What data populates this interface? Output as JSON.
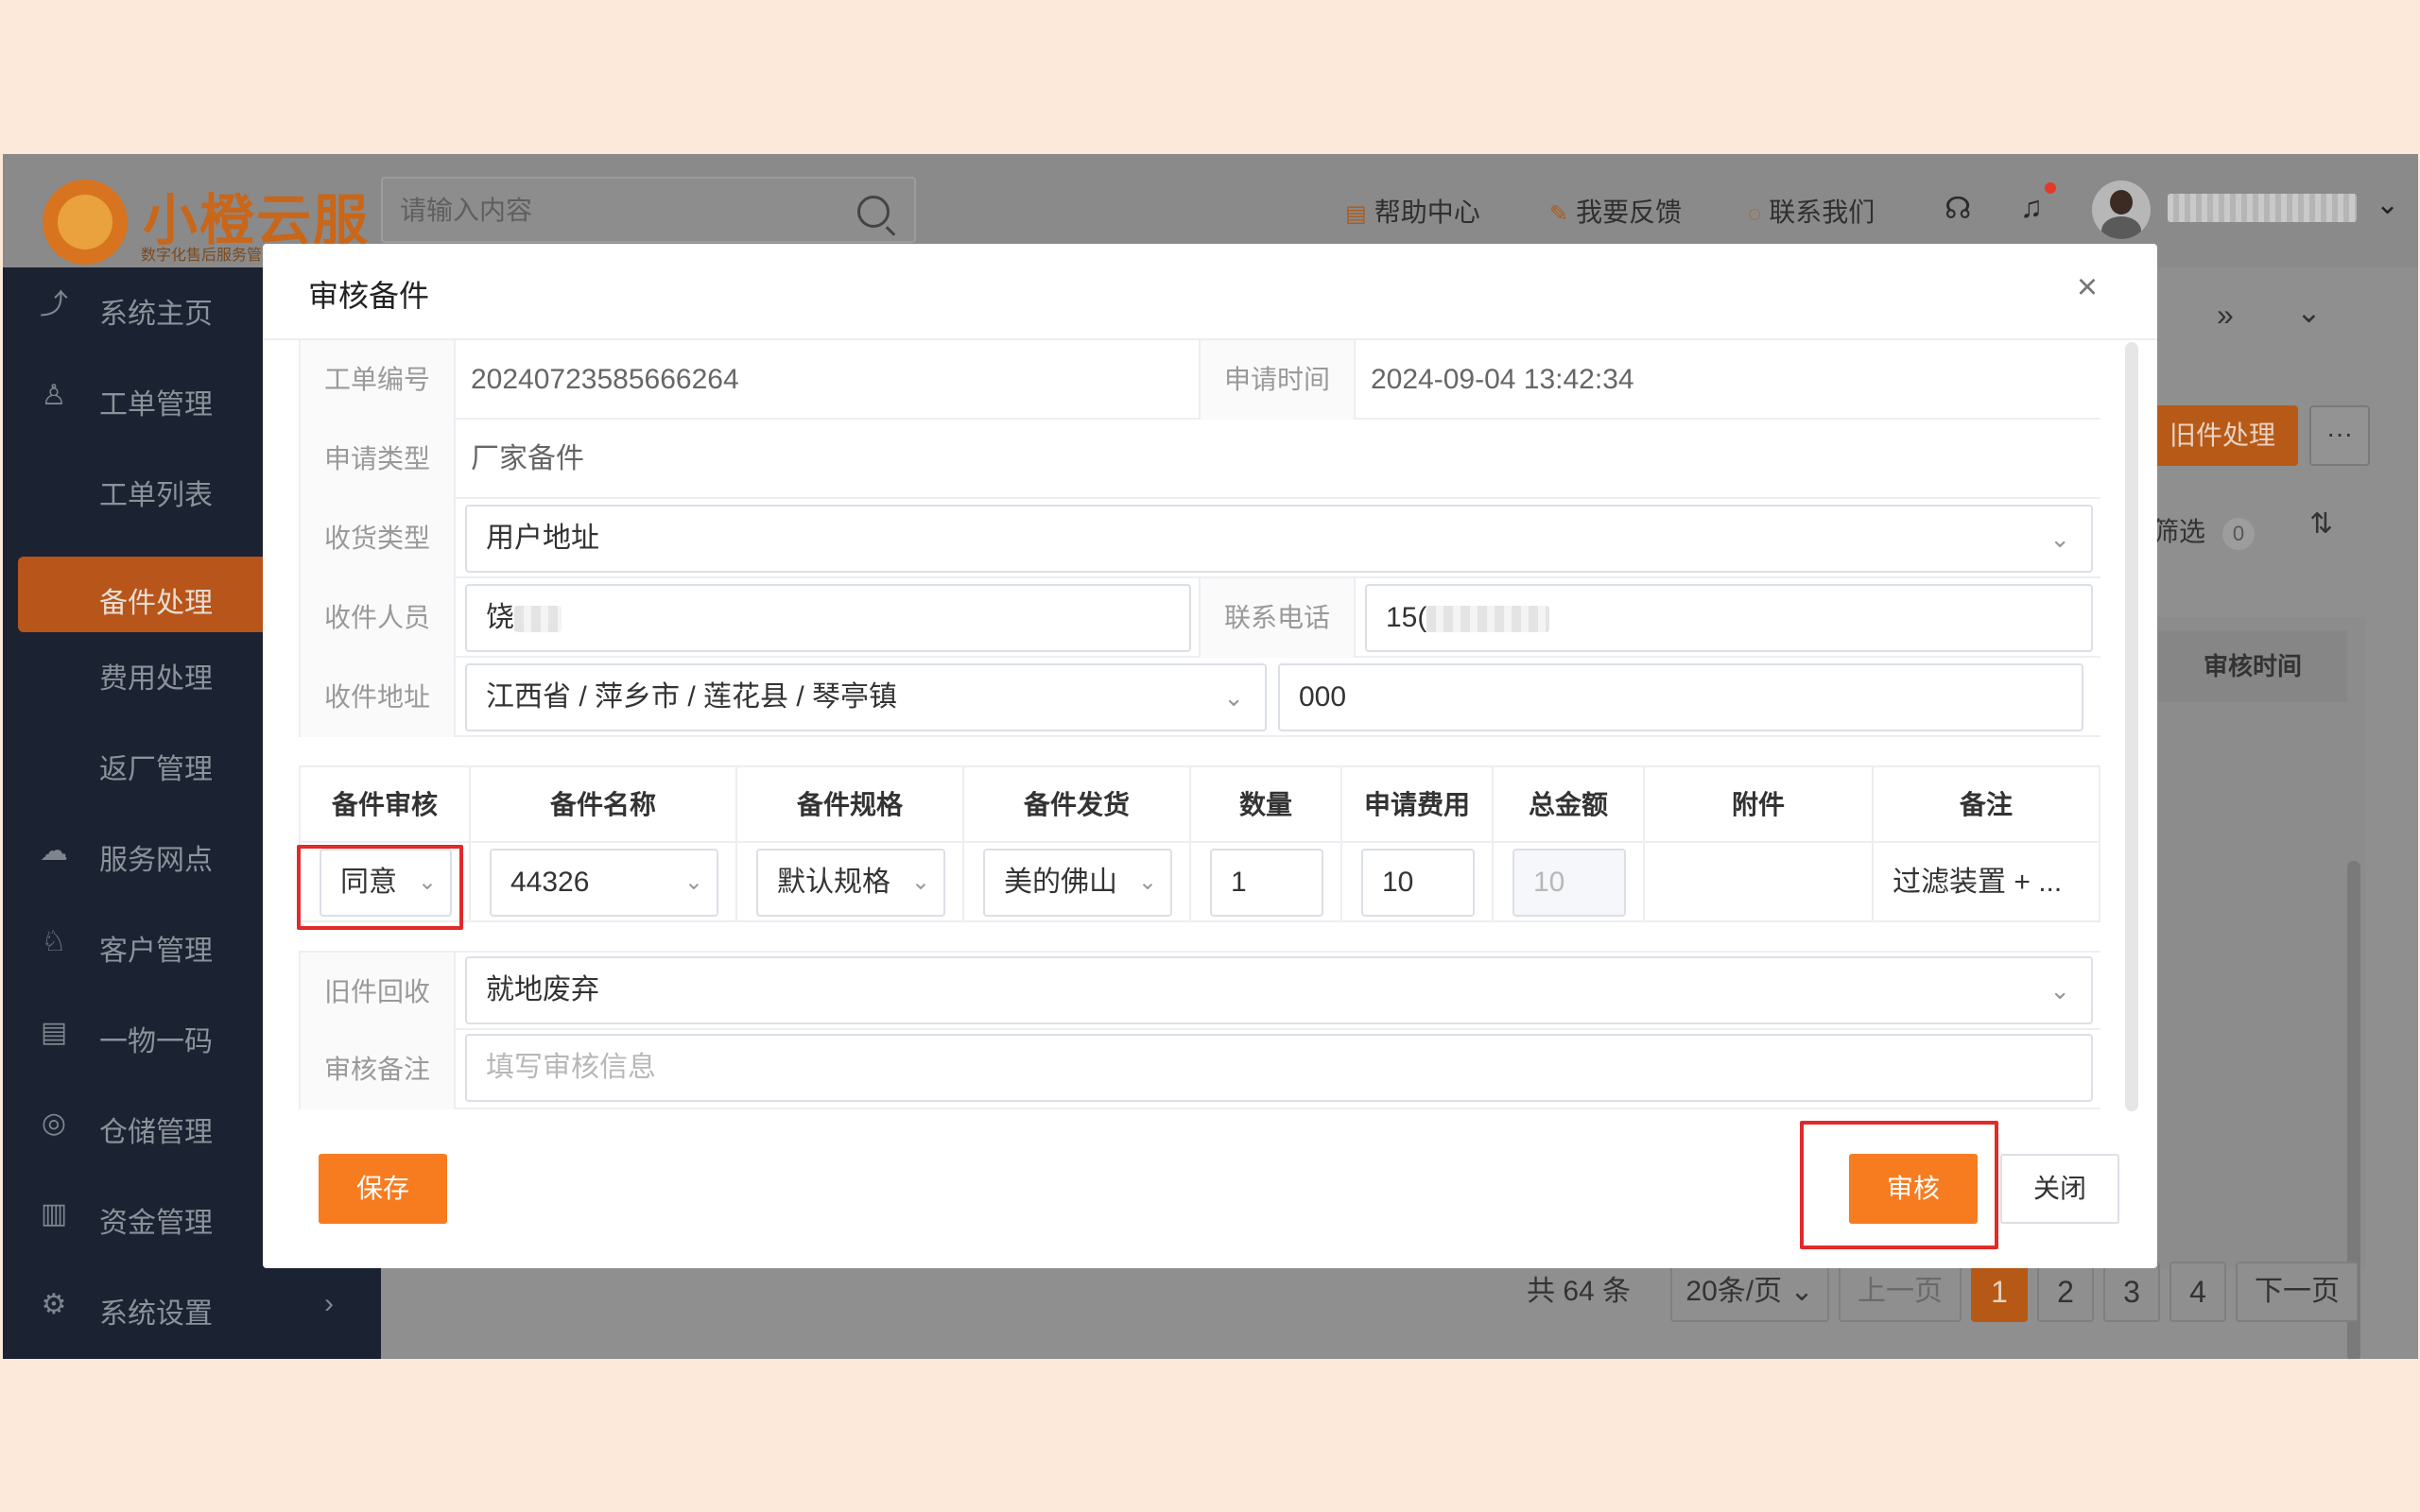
{
  "app": {
    "logo_title": "小橙云服",
    "logo_subtitle": "数字化售后服务管理系统",
    "search_placeholder": "请输入内容",
    "top_nav": {
      "help": "帮助中心",
      "feedback": "我要反馈",
      "contact": "联系我们"
    }
  },
  "sidebar": {
    "items": [
      {
        "label": "系统主页",
        "icon": "chart-icon"
      },
      {
        "label": "工单管理",
        "icon": "user-plus-icon"
      },
      {
        "label": "工单列表",
        "icon": ""
      },
      {
        "label": "备件处理",
        "icon": "",
        "active": true
      },
      {
        "label": "费用处理",
        "icon": ""
      },
      {
        "label": "返厂管理",
        "icon": ""
      },
      {
        "label": "服务网点",
        "icon": "cloud-icon"
      },
      {
        "label": "客户管理",
        "icon": "person-icon"
      },
      {
        "label": "一物一码",
        "icon": "clipboard-icon"
      },
      {
        "label": "仓储管理",
        "icon": "search-chat-icon"
      },
      {
        "label": "资金管理",
        "icon": "bar-chart-icon"
      },
      {
        "label": "系统设置",
        "icon": "gear-icon"
      }
    ]
  },
  "background": {
    "old_parts_button": "旧件处理",
    "more_button": "···",
    "filter_label": "筛选",
    "filter_count": "0",
    "column_audit_time": "审核时间",
    "pagination": {
      "total": "共 64 条",
      "page_size": "20条/页",
      "prev": "上一页",
      "pages": [
        "1",
        "2",
        "3",
        "4"
      ],
      "next": "下一页"
    }
  },
  "modal": {
    "title": "审核备件",
    "fields": {
      "order_no_label": "工单编号",
      "order_no": "20240723585666264",
      "apply_time_label": "申请时间",
      "apply_time": "2024-09-04 13:42:34",
      "apply_type_label": "申请类型",
      "apply_type": "厂家备件",
      "receive_type_label": "收货类型",
      "receive_type": "用户地址",
      "receiver_label": "收件人员",
      "receiver": "饶",
      "phone_label": "联系电话",
      "phone": "15(",
      "address_label": "收件地址",
      "address_region": "江西省 / 萍乡市 / 莲花县 / 琴亭镇",
      "address_detail": "000",
      "old_recycle_label": "旧件回收",
      "old_recycle": "就地废弃",
      "audit_note_label": "审核备注",
      "audit_note_placeholder": "填写审核信息"
    },
    "parts_table": {
      "headers": [
        "备件审核",
        "备件名称",
        "备件规格",
        "备件发货",
        "数量",
        "申请费用",
        "总金额",
        "附件",
        "备注"
      ],
      "row": {
        "audit": "同意",
        "name": "44326",
        "spec": "默认规格",
        "shipping": "美的佛山",
        "quantity": "1",
        "fee": "10",
        "total": "10",
        "attachment": "",
        "note": "过滤装置 + ..."
      }
    },
    "buttons": {
      "save": "保存",
      "audit": "审核",
      "close": "关闭"
    }
  },
  "colors": {
    "accent": "#f77c20",
    "highlight": "#e12a2a",
    "sidebar_bg": "#1b2231"
  }
}
